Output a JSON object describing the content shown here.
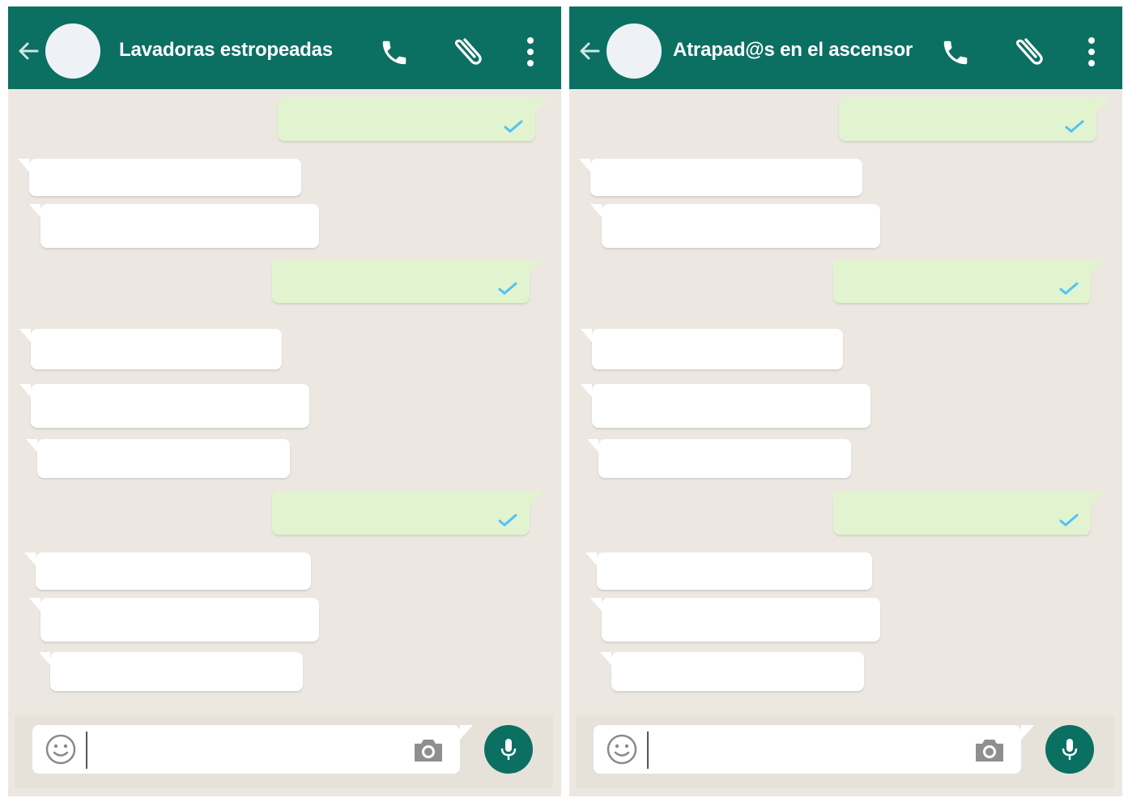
{
  "colors": {
    "header": "#0b6f62",
    "wallpaper": "#ece8e1",
    "incoming_bubble": "#ffffff",
    "outgoing_bubble": "#e1f4cf",
    "tick": "#4fc3f7"
  },
  "icons": {
    "back": "arrow-left-icon",
    "call": "phone-icon",
    "attach": "paperclip-icon",
    "menu": "more-vertical-icon",
    "read": "check-icon",
    "emoji": "smiley-icon",
    "camera": "camera-icon",
    "mic": "microphone-icon"
  },
  "chats": [
    {
      "title": "Lavadoras estropeadas",
      "input": {
        "value": "",
        "placeholder": ""
      }
    },
    {
      "title": "Atrapad@s en el ascensor",
      "input": {
        "value": "",
        "placeholder": ""
      }
    }
  ]
}
